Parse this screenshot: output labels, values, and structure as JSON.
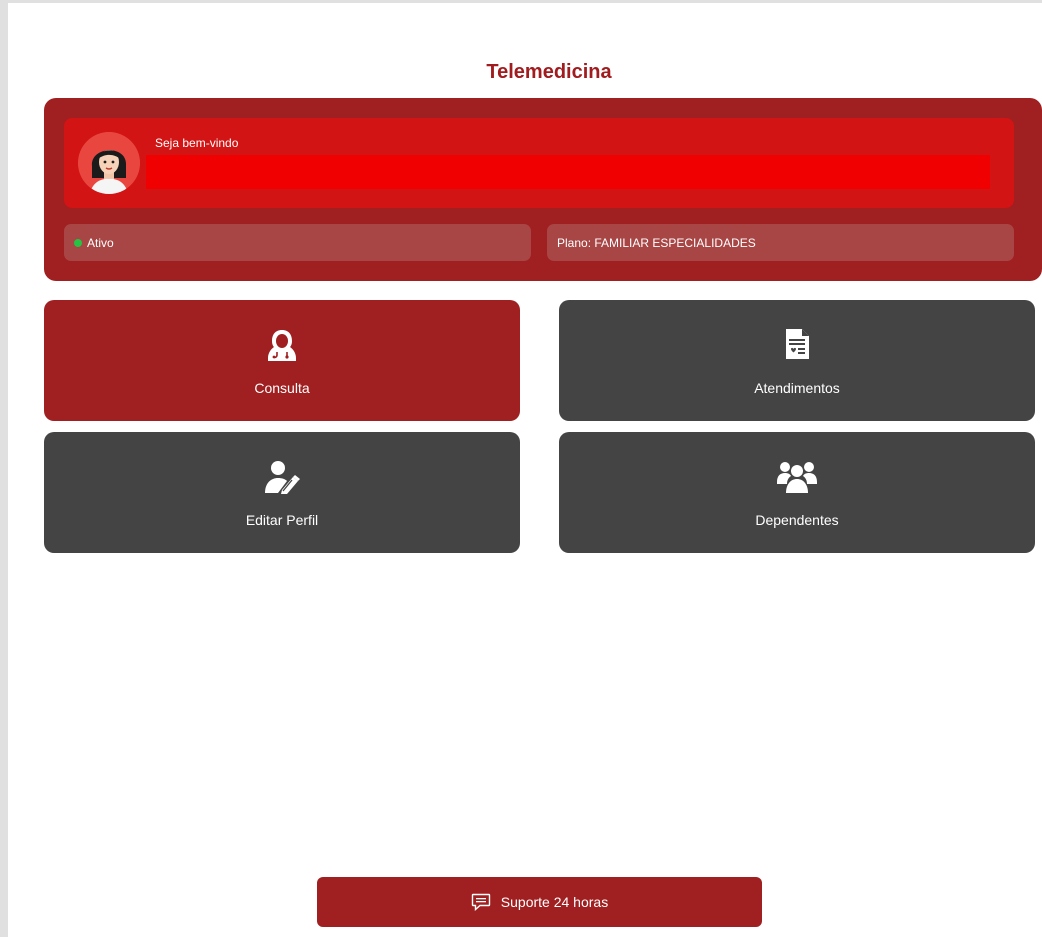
{
  "page": {
    "title": "Telemedicina"
  },
  "header": {
    "welcome": "Seja bem-vindo",
    "status_label": "Ativo",
    "plan_label": "Plano: FAMILIAR ESPECIALIDADES",
    "avatar_icon": "woman-avatar-icon"
  },
  "tiles": [
    {
      "label": "Consulta",
      "icon": "doctor-icon",
      "color": "#a01f20"
    },
    {
      "label": "Atendimentos",
      "icon": "medical-document-icon",
      "color": "#444444"
    },
    {
      "label": "Editar Perfil",
      "icon": "user-edit-icon",
      "color": "#444444"
    },
    {
      "label": "Dependentes",
      "icon": "users-group-icon",
      "color": "#444444"
    }
  ],
  "support": {
    "label": "Suporte 24 horas",
    "icon": "chat-icon"
  },
  "colors": {
    "brand": "#a01f20",
    "welcome_box": "#d21414",
    "status_active": "#25c244",
    "tile_gray": "#444444"
  }
}
